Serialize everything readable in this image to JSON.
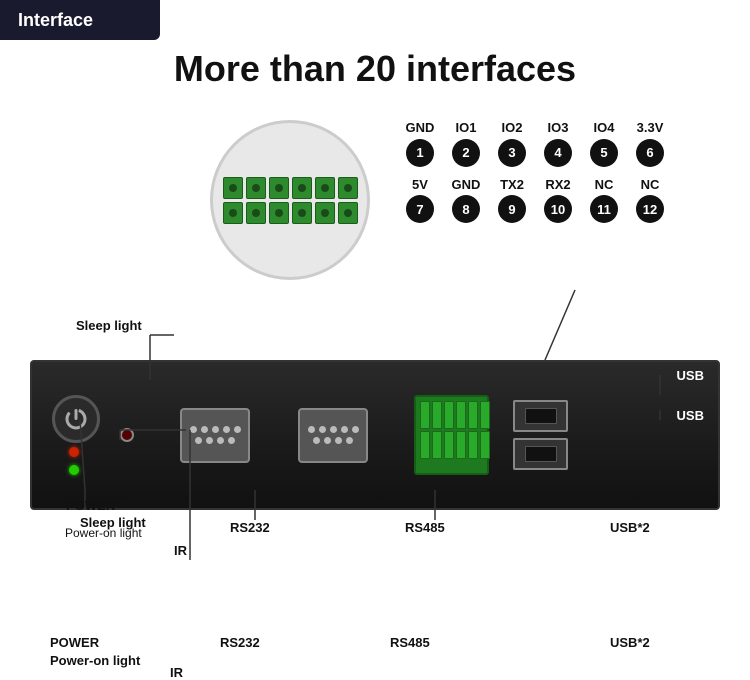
{
  "header": {
    "tab_label": "Interface",
    "tab_bg": "#1a1a2e",
    "tab_text": "#ffffff"
  },
  "main": {
    "title": "More than 20 interfaces"
  },
  "pin_labels_row1": [
    {
      "name": "GND",
      "number": "1"
    },
    {
      "name": "IO1",
      "number": "2"
    },
    {
      "name": "IO2",
      "number": "3"
    },
    {
      "name": "IO3",
      "number": "4"
    },
    {
      "name": "IO4",
      "number": "5"
    },
    {
      "name": "3.3V",
      "number": "6"
    }
  ],
  "pin_labels_row2": [
    {
      "name": "5V",
      "number": "7"
    },
    {
      "name": "GND",
      "number": "8"
    },
    {
      "name": "TX2",
      "number": "9"
    },
    {
      "name": "RX2",
      "number": "10"
    },
    {
      "name": "NC",
      "number": "11"
    },
    {
      "name": "NC",
      "number": "12"
    }
  ],
  "device_labels": {
    "power": "POWER",
    "ir": "IR",
    "rs232": "RS232",
    "rs485": "RS485",
    "usb2": "USB*2",
    "sleep_light": "Sleep light",
    "power_on_light": "Power-on light"
  },
  "usb_labels": {
    "usb1": "USB",
    "usb2": "USB"
  }
}
